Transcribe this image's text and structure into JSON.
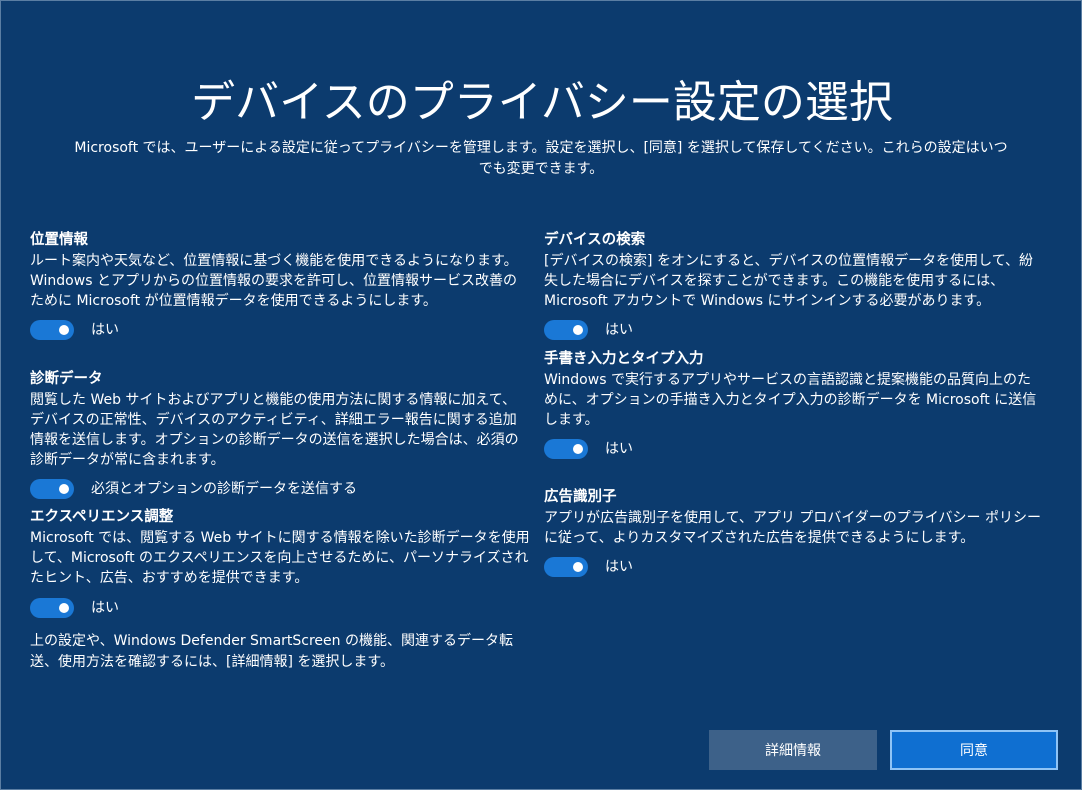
{
  "header": {
    "title": "デバイスのプライバシー設定の選択",
    "subtitle": "Microsoft では、ユーザーによる設定に従ってプライバシーを管理します。設定を選択し、[同意] を選択して保存してください。これらの設定はいつでも変更できます。"
  },
  "left_sections": [
    {
      "title": "位置情報",
      "description": "ルート案内や天気など、位置情報に基づく機能を使用できるようになります。Windows とアプリからの位置情報の要求を許可し、位置情報サービス改善のために Microsoft が位置情報データを使用できるようにします。",
      "toggle_label": "はい",
      "toggle_on": true
    },
    {
      "title": "診断データ",
      "description": "閲覧した Web サイトおよびアプリと機能の使用方法に関する情報に加えて、デバイスの正常性、デバイスのアクティビティ、詳細エラー報告に関する追加情報を送信します。オプションの診断データの送信を選択した場合は、必須の診断データが常に含まれます。",
      "toggle_label": "必須とオプションの診断データを送信する",
      "toggle_on": true
    },
    {
      "title": "エクスペリエンス調整",
      "description": "Microsoft では、閲覧する Web サイトに関する情報を除いた診断データを使用して、Microsoft のエクスペリエンスを向上させるために、パーソナライズされたヒント、広告、おすすめを提供できます。",
      "toggle_label": "はい",
      "toggle_on": true
    }
  ],
  "right_sections": [
    {
      "title": "デバイスの検索",
      "description": "[デバイスの検索] をオンにすると、デバイスの位置情報データを使用して、紛失した場合にデバイスを探すことができます。この機能を使用するには、Microsoft アカウントで Windows にサインインする必要があります。",
      "toggle_label": "はい",
      "toggle_on": true
    },
    {
      "title": "手書き入力とタイプ入力",
      "description": "Windows で実行するアプリやサービスの言語認識と提案機能の品質向上のために、オプションの手描き入力とタイプ入力の診断データを Microsoft に送信します。",
      "toggle_label": "はい",
      "toggle_on": true
    },
    {
      "title": "広告識別子",
      "description": "アプリが広告識別子を使用して、アプリ プロバイダーのプライバシー ポリシーに従って、よりカスタマイズされた広告を提供できるようにします。",
      "toggle_label": "はい",
      "toggle_on": true
    }
  ],
  "footnote": "上の設定や、Windows Defender SmartScreen の機能、関連するデータ転送、使用方法を確認するには、[詳細情報] を選択します。",
  "buttons": {
    "details": "詳細情報",
    "accept": "同意"
  },
  "colors": {
    "background": "#0c3b6e",
    "toggle_on": "#1a78d6",
    "button_secondary": "#3d6189",
    "button_primary": "#0f6fd1"
  }
}
